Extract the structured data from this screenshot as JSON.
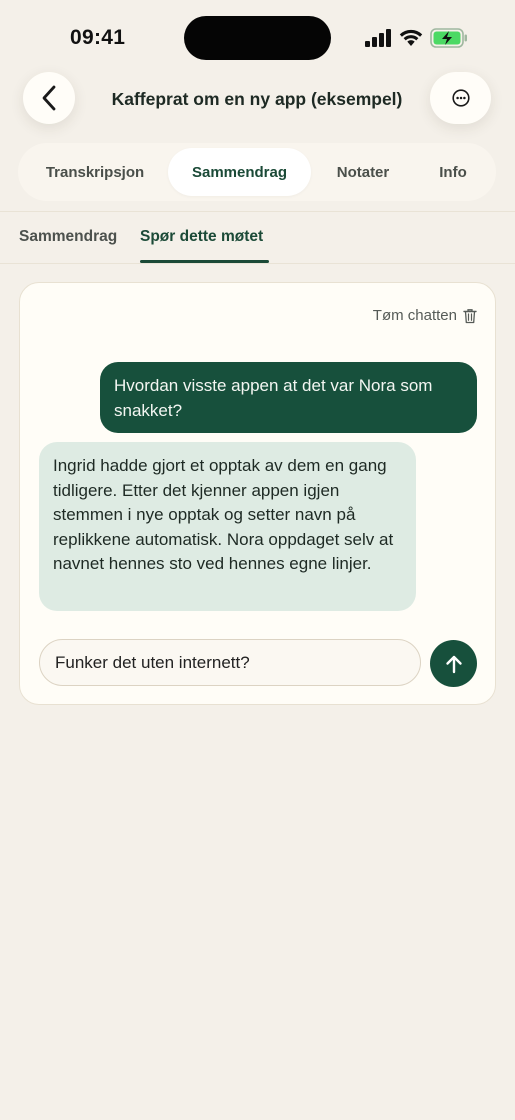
{
  "status_bar": {
    "time": "09:41"
  },
  "header": {
    "title": "Kaffeprat om en ny app (eksempel)",
    "back_icon": "chevron-left-icon",
    "more_icon": "ellipsis-circle-icon"
  },
  "main_tabs": [
    {
      "label": "Transkripsjon",
      "active": false
    },
    {
      "label": "Sammendrag",
      "active": true
    },
    {
      "label": "Notater",
      "active": false
    },
    {
      "label": "Info",
      "active": false
    }
  ],
  "sub_tabs": [
    {
      "label": "Sammendrag",
      "active": false
    },
    {
      "label": "Spør dette møtet",
      "active": true
    }
  ],
  "chat": {
    "clear_label": "Tøm chatten",
    "messages": [
      {
        "role": "user",
        "text": "Hvordan visste appen at det var Nora som snakket?"
      },
      {
        "role": "assistant",
        "text": "Ingrid hadde gjort et opptak av dem en gang tidligere. Etter det kjenner appen igjen stemmen i nye opptak og setter navn på replikkene automatisk. Nora oppdaget selv at navnet hennes sto ved hennes egne linjer."
      }
    ],
    "input_value": "Funker det uten internett?"
  },
  "colors": {
    "accent": "#17503c",
    "background": "#f4f0e9",
    "bot_bubble": "#deebe3",
    "battery": "#4cd964"
  }
}
